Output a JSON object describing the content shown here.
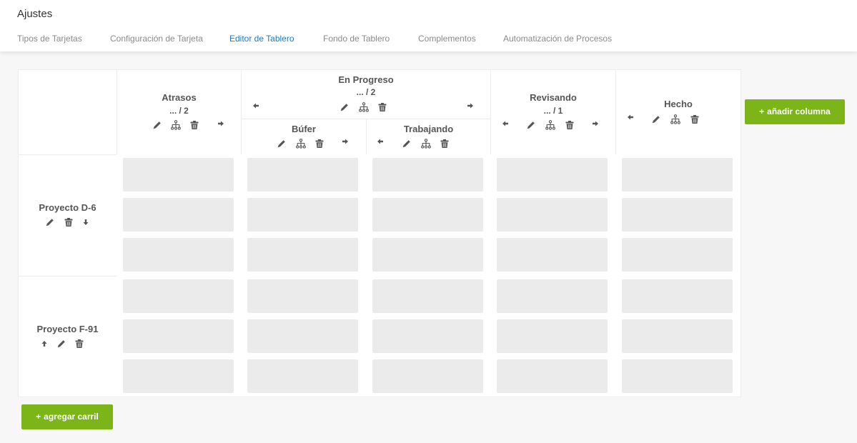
{
  "app": {
    "title": "Ajustes"
  },
  "tabs": [
    {
      "label": "Tipos de Tarjetas",
      "active": false
    },
    {
      "label": "Configuración de Tarjeta",
      "active": false
    },
    {
      "label": "Editor de Tablero",
      "active": true
    },
    {
      "label": "Fondo de Tablero",
      "active": false
    },
    {
      "label": "Complementos",
      "active": false
    },
    {
      "label": "Automatización de Procesos",
      "active": false
    }
  ],
  "columns": {
    "atrasos": {
      "name": "Atrasos",
      "limit": "... / 2"
    },
    "en_progreso": {
      "name": "En Progreso",
      "limit": "... / 2",
      "subcolumns": {
        "bufer": {
          "name": "Búfer"
        },
        "trabajando": {
          "name": "Trabajando"
        }
      }
    },
    "revisando": {
      "name": "Revisando",
      "limit": "... / 1"
    },
    "hecho": {
      "name": "Hecho"
    }
  },
  "lanes": [
    {
      "name": "Proyecto D-6"
    },
    {
      "name": "Proyecto F-91"
    }
  ],
  "buttons": {
    "add_column": "añadir columna",
    "add_lane": "agregar carril",
    "plus": "+"
  },
  "colors": {
    "accent": "#7cb518",
    "active_tab": "#1a7bc4",
    "placeholder": "#ebebeb"
  },
  "icons": [
    "pencil-icon",
    "hierarchy-icon",
    "trash-icon",
    "arrow-left-icon",
    "arrow-right-icon",
    "arrow-up-icon",
    "arrow-down-icon",
    "plus-icon"
  ]
}
